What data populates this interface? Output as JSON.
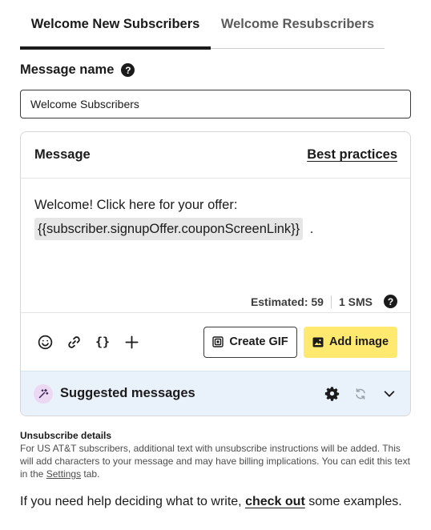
{
  "tabs": [
    {
      "label": "Welcome New Subscribers",
      "active": true
    },
    {
      "label": "Welcome Resubscribers",
      "active": false
    }
  ],
  "message_name": {
    "label": "Message name",
    "help_icon": "?",
    "value": "Welcome Subscribers"
  },
  "message": {
    "title": "Message",
    "best_practices": "Best practices",
    "text": "Welcome! Click here for your offer:",
    "token": "{{subscriber.signupOffer.couponScreenLink}}",
    "after_token": ".",
    "estimated": "Estimated: 59",
    "sms_count": "1 SMS",
    "help_icon": "?"
  },
  "toolbar": {
    "icons": [
      "emoji-icon",
      "link-icon",
      "braces-icon",
      "plus-icon"
    ],
    "braces_glyph": "{}",
    "create_gif": "Create GIF",
    "add_image": "Add image",
    "add_image_color": "#ffe96e"
  },
  "suggested": {
    "title": "Suggested messages",
    "background": "#e9f1fb"
  },
  "unsubscribe": {
    "title": "Unsubscribe details",
    "text_before": "For US AT&T subscribers, additional text with unsubscribe instructions will be added. This will add characters to your message and may have billing implications. You can edit this text in the",
    "settings_link": "Settings",
    "text_after": "tab."
  },
  "help": {
    "before": "If you need help deciding what to write,",
    "link": "check out",
    "after": "some examples."
  }
}
